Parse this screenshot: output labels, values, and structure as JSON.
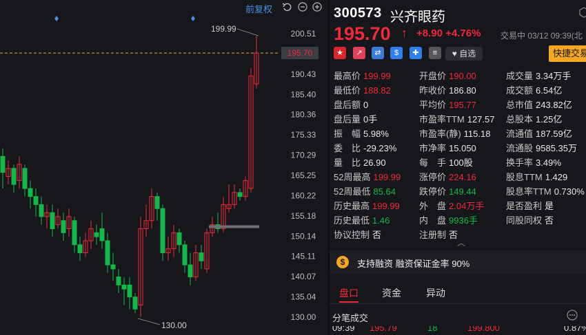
{
  "chart_controls": {
    "adjust_label": "前复权"
  },
  "chart_data": {
    "type": "candlestick",
    "y_ticks": [
      "200.51",
      "195.70",
      "190.43",
      "185.40",
      "180.36",
      "175.33",
      "170.29",
      "165.25",
      "160.22",
      "155.18",
      "150.14",
      "145.11",
      "140.07",
      "135.04",
      "130.00"
    ],
    "ylim": [
      130.0,
      200.51
    ],
    "high_annotation": "199.99",
    "low_annotation": "130.00",
    "current_price_line": "195.70",
    "colors": {
      "up": "#f2283b",
      "down": "#12b84a",
      "price_line": "#f5a623",
      "axis_tag": "#3a3d44"
    }
  },
  "quote": {
    "code": "300573",
    "name": "兴齐眼药",
    "price": "195.70",
    "arrow": "↑",
    "change": "+8.90",
    "change_pct": "+4.76%",
    "status": "交易中 03/12 09:39(北",
    "favorite": "自选",
    "fast_trade": "快捷交易"
  },
  "stats": [
    [
      {
        "label": "最高价",
        "value": "199.99",
        "color": "red"
      },
      {
        "label": "开盘价",
        "value": "190.00",
        "color": "red"
      },
      {
        "label": "成交量",
        "value": "3.34万手",
        "color": "wht"
      }
    ],
    [
      {
        "label": "最低价",
        "value": "188.82",
        "color": "red"
      },
      {
        "label": "昨收价",
        "value": "186.80",
        "color": "wht"
      },
      {
        "label": "成交额",
        "value": "6.54亿",
        "color": "wht"
      }
    ],
    [
      {
        "label": "盘后额",
        "value": "0",
        "color": "wht"
      },
      {
        "label": "平均价",
        "value": "195.77",
        "color": "red"
      },
      {
        "label": "总市值",
        "value": "243.82亿",
        "color": "wht"
      }
    ],
    [
      {
        "label": "盘后量",
        "value": "0手",
        "color": "wht"
      },
      {
        "label": "市盈率TTM",
        "value": "127.57",
        "color": "wht"
      },
      {
        "label": "总股本",
        "value": "1.25亿",
        "color": "wht"
      }
    ],
    [
      {
        "label": "振　幅",
        "value": "5.98%",
        "color": "wht"
      },
      {
        "label": "市盈率(静)",
        "value": "115.18",
        "color": "wht"
      },
      {
        "label": "流通值",
        "value": "187.59亿",
        "color": "wht"
      }
    ],
    [
      {
        "label": "委　比",
        "value": "-29.23%",
        "color": "wht"
      },
      {
        "label": "市净率",
        "value": "15.050",
        "color": "wht"
      },
      {
        "label": "流通股",
        "value": "9585.35万",
        "color": "wht"
      }
    ],
    [
      {
        "label": "量　比",
        "value": "26.90",
        "color": "wht"
      },
      {
        "label": "每　手",
        "value": "100股",
        "color": "wht"
      },
      {
        "label": "换手率",
        "value": "3.49%",
        "color": "wht"
      }
    ],
    [
      {
        "label": "52周最高",
        "value": "199.99",
        "color": "red"
      },
      {
        "label": "涨停价",
        "value": "224.16",
        "color": "red"
      },
      {
        "label": "股息TTM",
        "value": "1.429",
        "color": "wht"
      }
    ],
    [
      {
        "label": "52周最低",
        "value": "85.64",
        "color": "grn"
      },
      {
        "label": "跌停价",
        "value": "149.44",
        "color": "grn"
      },
      {
        "label": "股息率TTM",
        "value": "0.730%",
        "color": "wht"
      }
    ],
    [
      {
        "label": "历史最高",
        "value": "199.99",
        "color": "red"
      },
      {
        "label": "外　盘",
        "value": "2.04万手",
        "color": "red"
      },
      {
        "label": "是否盈利",
        "value": "是",
        "color": "wht"
      }
    ],
    [
      {
        "label": "历史最低",
        "value": "1.46",
        "color": "grn"
      },
      {
        "label": "内　盘",
        "value": "9936手",
        "color": "grn"
      },
      {
        "label": "同股同权",
        "value": "否",
        "color": "wht"
      }
    ],
    [
      {
        "label": "协议控制",
        "value": "否",
        "color": "wht"
      },
      {
        "label": "注册制",
        "value": "否",
        "color": "wht"
      }
    ]
  ],
  "margin": {
    "text": "支持融资 融资保证金率 90%"
  },
  "tabs": [
    "盘口",
    "资金",
    "异动"
  ],
  "trades": {
    "title": "分笔成交",
    "row": [
      "09:39",
      "195.79",
      "18",
      "199.800",
      "0.87%"
    ]
  },
  "colors": {
    "red": "#f2283b",
    "green": "#12b84a",
    "bg": "#16171b"
  }
}
